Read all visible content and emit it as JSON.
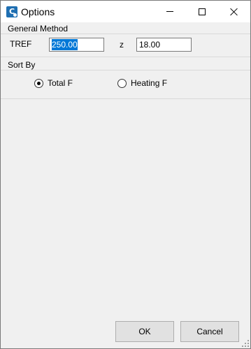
{
  "window": {
    "title": "Options",
    "icon_glyph": "C"
  },
  "general_method": {
    "header": "General Method",
    "tref_label": "TREF",
    "tref_value": "250.00",
    "z_label": "z",
    "z_value": "18.00"
  },
  "sort_by": {
    "header": "Sort By",
    "options": [
      {
        "label": "Total F",
        "selected": true
      },
      {
        "label": "Heating F",
        "selected": false
      }
    ]
  },
  "buttons": {
    "ok_label": "OK",
    "cancel_label": "Cancel"
  },
  "colors": {
    "selection": "#0078d7",
    "app_icon": "#1f6fb2"
  }
}
